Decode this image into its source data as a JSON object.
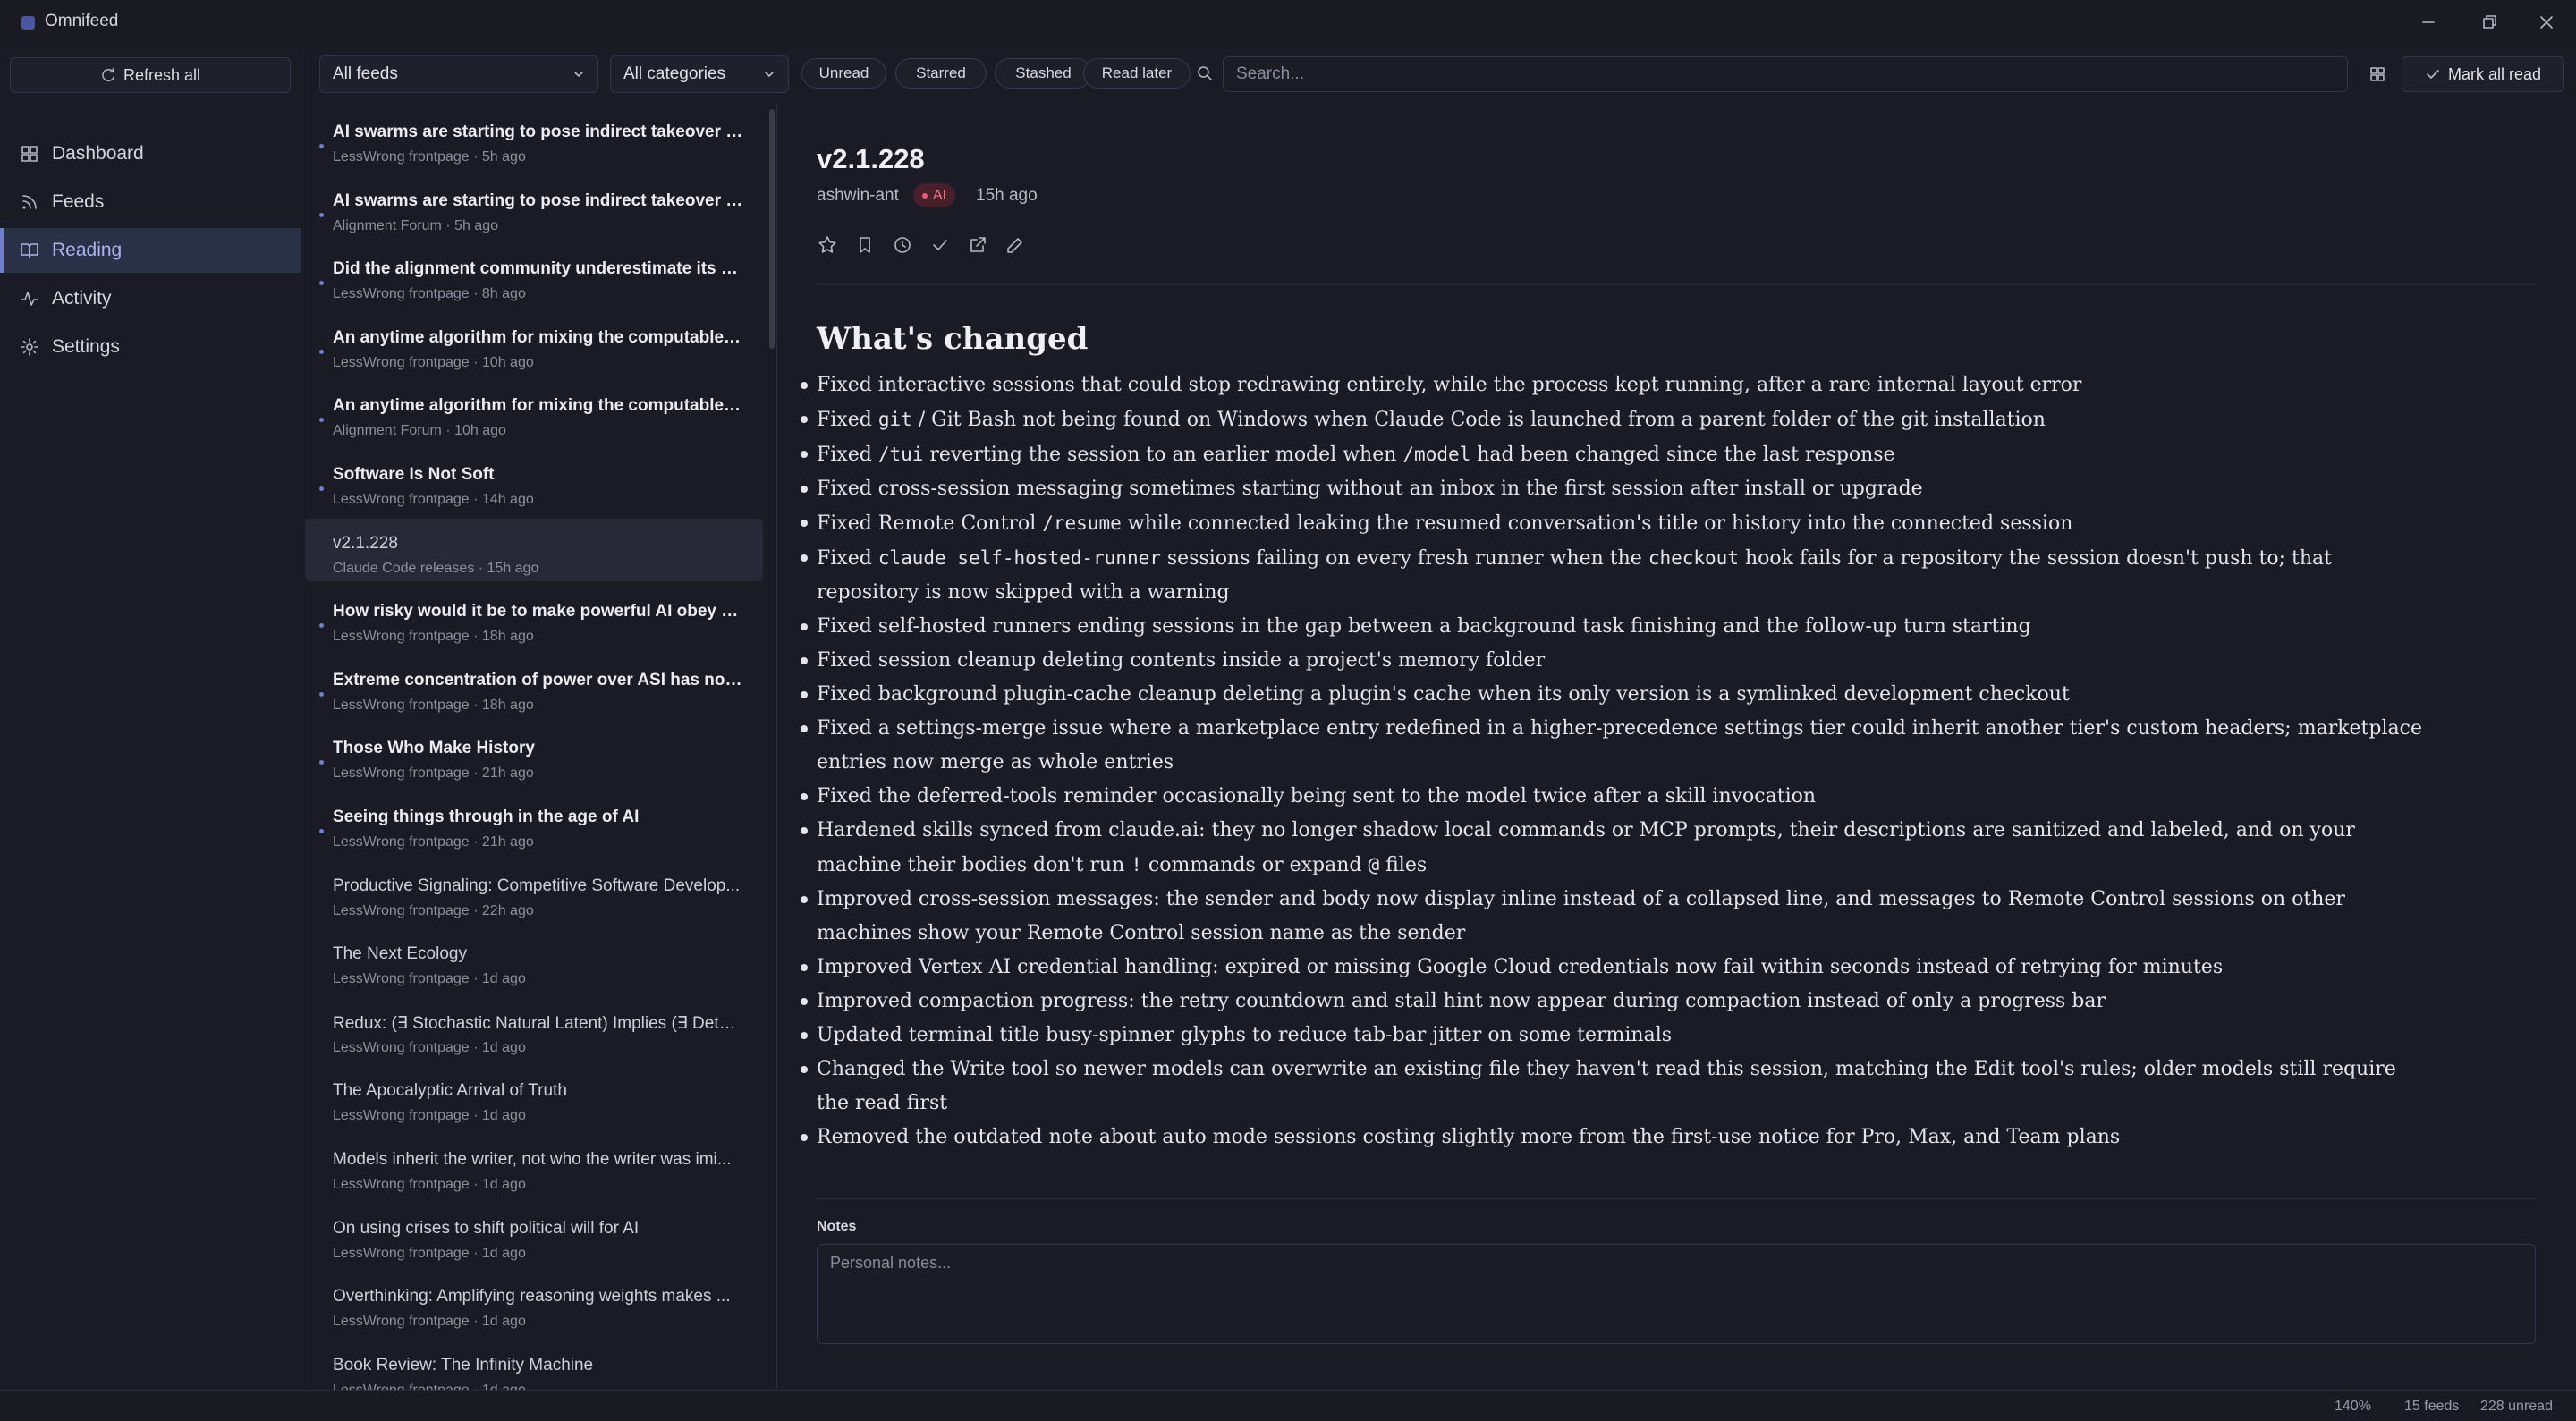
{
  "window": {
    "title": "Omnifeed"
  },
  "sidebar": {
    "refresh_label": "Refresh all",
    "items": [
      {
        "label": "Dashboard",
        "icon": "grid-icon"
      },
      {
        "label": "Feeds",
        "icon": "rss-icon"
      },
      {
        "label": "Reading",
        "icon": "book-icon",
        "active": true
      },
      {
        "label": "Activity",
        "icon": "activity-icon"
      },
      {
        "label": "Settings",
        "icon": "gear-icon"
      }
    ]
  },
  "toolbar": {
    "feed_filter": "All feeds",
    "category_filter": "All categories",
    "filters": [
      "Unread",
      "Starred",
      "Stashed",
      "Read later"
    ],
    "search_placeholder": "Search...",
    "mark_all_read_label": "Mark all read"
  },
  "articles": [
    {
      "title": "AI swarms are starting to pose indirect takeover risk",
      "source": "LessWrong frontpage",
      "time": "5h ago",
      "unread": true
    },
    {
      "title": "AI swarms are starting to pose indirect takeover risk",
      "source": "Alignment Forum",
      "time": "5h ago",
      "unread": true
    },
    {
      "title": "Did the alignment community underestimate its po...",
      "source": "LessWrong frontpage",
      "time": "8h ago",
      "unread": true
    },
    {
      "title": "An anytime algorithm for mixing the computable m...",
      "source": "LessWrong frontpage",
      "time": "10h ago",
      "unread": true
    },
    {
      "title": "An anytime algorithm for mixing the computable m...",
      "source": "Alignment Forum",
      "time": "10h ago",
      "unread": true
    },
    {
      "title": "Software Is Not Soft",
      "source": "LessWrong frontpage",
      "time": "14h ago",
      "unread": true
    },
    {
      "title": "v2.1.228",
      "source": "Claude Code releases",
      "time": "15h ago",
      "unread": false,
      "selected": true
    },
    {
      "title": "How risky would it be to make powerful AI obey on...",
      "source": "LessWrong frontpage",
      "time": "18h ago",
      "unread": true
    },
    {
      "title": "Extreme concentration of power over ASI has non-...",
      "source": "LessWrong frontpage",
      "time": "18h ago",
      "unread": true
    },
    {
      "title": "Those Who Make History",
      "source": "LessWrong frontpage",
      "time": "21h ago",
      "unread": true
    },
    {
      "title": "Seeing things through in the age of AI",
      "source": "LessWrong frontpage",
      "time": "21h ago",
      "unread": true
    },
    {
      "title": "Productive Signaling: Competitive Software Develop...",
      "source": "LessWrong frontpage",
      "time": "22h ago",
      "unread": false
    },
    {
      "title": "The Next Ecology",
      "source": "LessWrong frontpage",
      "time": "1d ago",
      "unread": false
    },
    {
      "title": "Redux: (∃ Stochastic Natural Latent) Implies (∃ Deter...",
      "source": "LessWrong frontpage",
      "time": "1d ago",
      "unread": false
    },
    {
      "title": "The Apocalyptic Arrival of Truth",
      "source": "LessWrong frontpage",
      "time": "1d ago",
      "unread": false
    },
    {
      "title": "Models inherit the writer, not who the writer was imi...",
      "source": "LessWrong frontpage",
      "time": "1d ago",
      "unread": false
    },
    {
      "title": "On using crises to shift political will for AI",
      "source": "LessWrong frontpage",
      "time": "1d ago",
      "unread": false
    },
    {
      "title": "Overthinking: Amplifying reasoning weights makes ...",
      "source": "LessWrong frontpage",
      "time": "1d ago",
      "unread": false
    },
    {
      "title": "Book Review: The Infinity Machine",
      "source": "LessWrong frontpage",
      "time": "1d ago",
      "unread": false
    }
  ],
  "article": {
    "title": "v2.1.228",
    "author": "ashwin-ant",
    "category": "AI",
    "time": "15h ago",
    "heading": "What's changed",
    "changes": [
      [
        {
          "t": "Fixed interactive sessions that could stop redrawing entirely, while the process kept running, after a rare internal layout error"
        }
      ],
      [
        {
          "t": "Fixed "
        },
        {
          "c": "git"
        },
        {
          "t": " / Git Bash not being found on Windows when Claude Code is launched from a parent folder of the git installation"
        }
      ],
      [
        {
          "t": "Fixed "
        },
        {
          "c": "/tui"
        },
        {
          "t": " reverting the session to an earlier model when "
        },
        {
          "c": "/model"
        },
        {
          "t": " had been changed since the last response"
        }
      ],
      [
        {
          "t": "Fixed cross-session messaging sometimes starting without an inbox in the first session after install or upgrade"
        }
      ],
      [
        {
          "t": "Fixed Remote Control "
        },
        {
          "c": "/resume"
        },
        {
          "t": " while connected leaking the resumed conversation's title or history into the connected session"
        }
      ],
      [
        {
          "t": "Fixed "
        },
        {
          "c": "claude self-hosted-runner"
        },
        {
          "t": " sessions failing on every fresh runner when the "
        },
        {
          "c": "checkout"
        },
        {
          "t": " hook fails for a repository the session doesn't push to; that repository is now skipped with a warning"
        }
      ],
      [
        {
          "t": "Fixed self-hosted runners ending sessions in the gap between a background task finishing and the follow-up turn starting"
        }
      ],
      [
        {
          "t": "Fixed session cleanup deleting contents inside a project's memory folder"
        }
      ],
      [
        {
          "t": "Fixed background plugin-cache cleanup deleting a plugin's cache when its only version is a symlinked development checkout"
        }
      ],
      [
        {
          "t": "Fixed a settings-merge issue where a marketplace entry redefined in a higher-precedence settings tier could inherit another tier's custom headers; marketplace entries now merge as whole entries"
        }
      ],
      [
        {
          "t": "Fixed the deferred-tools reminder occasionally being sent to the model twice after a skill invocation"
        }
      ],
      [
        {
          "t": "Hardened skills synced from claude.ai: they no longer shadow local commands or MCP prompts, their descriptions are sanitized and labeled, and on your machine their bodies don't run "
        },
        {
          "c": "!"
        },
        {
          "t": " commands or expand "
        },
        {
          "c": "@"
        },
        {
          "t": " files"
        }
      ],
      [
        {
          "t": "Improved cross-session messages: the sender and body now display inline instead of a collapsed line, and messages to Remote Control sessions on other machines show your Remote Control session name as the sender"
        }
      ],
      [
        {
          "t": "Improved Vertex AI credential handling: expired or missing Google Cloud credentials now fail within seconds instead of retrying for minutes"
        }
      ],
      [
        {
          "t": "Improved compaction progress: the retry countdown and stall hint now appear during compaction instead of only a progress bar"
        }
      ],
      [
        {
          "t": "Updated terminal title busy-spinner glyphs to reduce tab-bar jitter on some terminals"
        }
      ],
      [
        {
          "t": "Changed the Write tool so newer models can overwrite an existing file they haven't read this session, matching the Edit tool's rules; older models still require the read first"
        }
      ],
      [
        {
          "t": "Removed the outdated note about auto mode sessions costing slightly more from the first-use notice for Pro, Max, and Team plans"
        }
      ]
    ],
    "notes_label": "Notes",
    "notes_placeholder": "Personal notes..."
  },
  "status": {
    "zoom": "140%",
    "feeds": "15 feeds",
    "unread": "228 unread"
  },
  "colors": {
    "accent": "#6f7fd6",
    "badge_bg": "#47202b",
    "badge_text": "#f07b8e",
    "background": "#1b1b25"
  }
}
